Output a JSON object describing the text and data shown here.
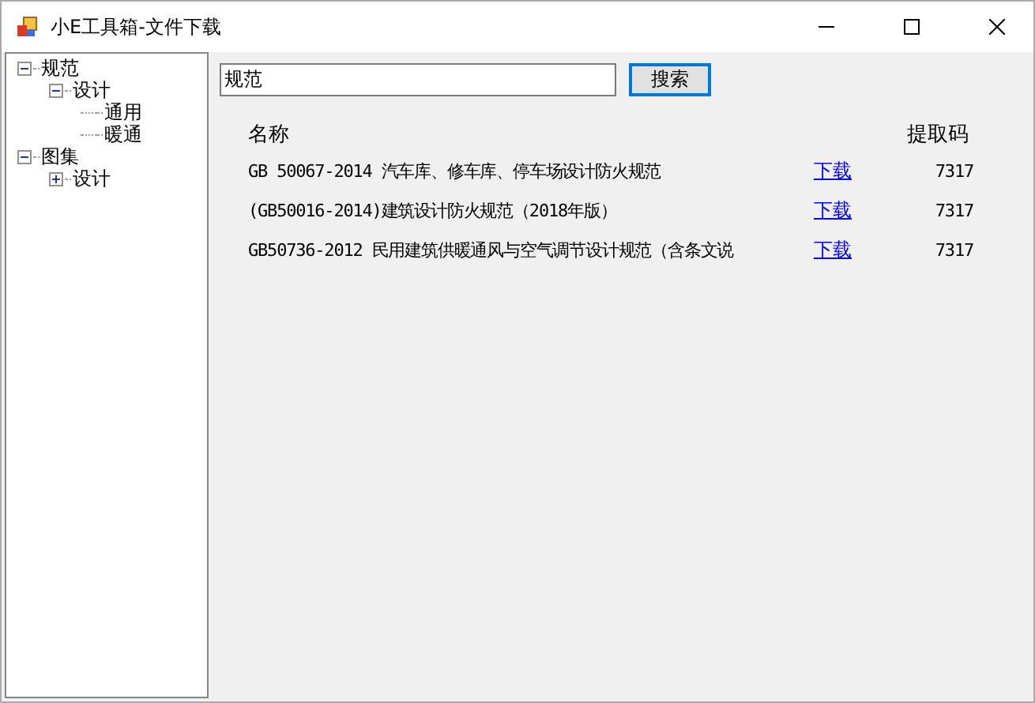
{
  "window": {
    "title": "小E工具箱-文件下载"
  },
  "tree": [
    {
      "label": "规范",
      "expanded": true,
      "children": [
        {
          "label": "设计",
          "expanded": true,
          "children": [
            {
              "label": "通用"
            },
            {
              "label": "暖通"
            }
          ]
        }
      ]
    },
    {
      "label": "图集",
      "expanded": true,
      "children": [
        {
          "label": "设计",
          "expanded": false
        }
      ]
    }
  ],
  "search": {
    "value": "规范",
    "button": "搜索"
  },
  "table": {
    "columns": [
      "名称",
      "提取码"
    ],
    "rows": [
      {
        "name": "GB 50067-2014 汽车库、修车库、停车场设计防火规范",
        "link": "下载",
        "code": "7317"
      },
      {
        "name": "(GB50016-2014)建筑设计防火规范（2018年版）",
        "link": "下载",
        "code": "7317"
      },
      {
        "name": "GB50736-2012 民用建筑供暖通风与空气调节设计规范（含条文说",
        "link": "下载",
        "code": "7317"
      }
    ]
  }
}
